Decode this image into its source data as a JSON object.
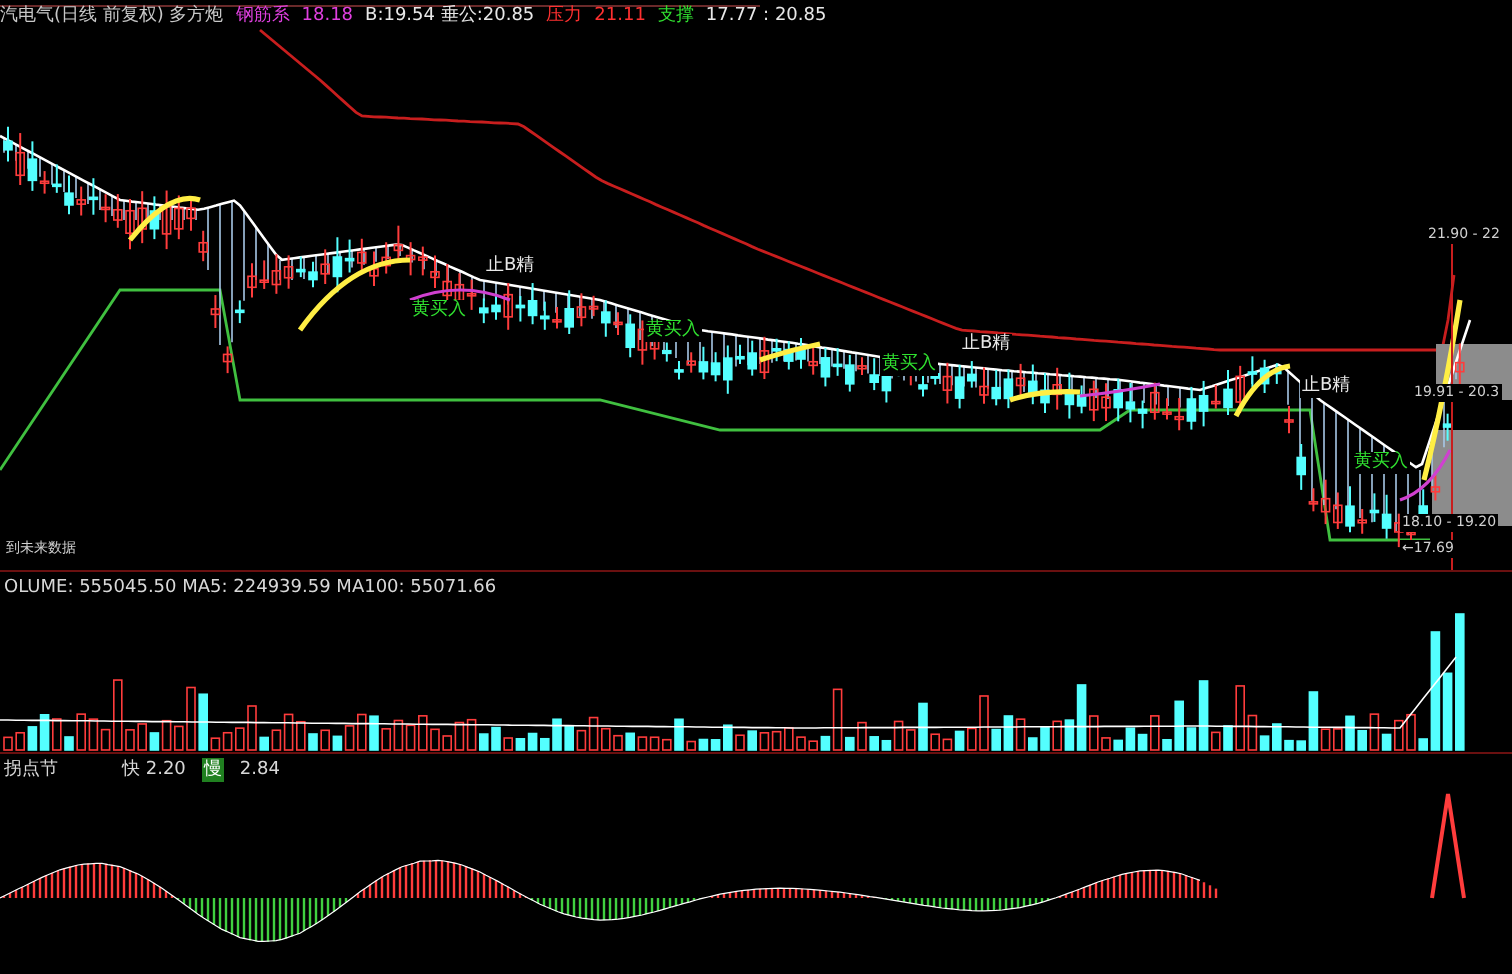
{
  "header": [
    {
      "text": "汽电气(日线 前复权) 多方炮",
      "color": "#c8c8c8"
    },
    {
      "text": "钢筋系",
      "color": "#e040e0"
    },
    {
      "text": "18.18",
      "color": "#e040e0"
    },
    {
      "text": "B:19.54 垂公:20.85",
      "color": "#e8e8e8"
    },
    {
      "text": "压力",
      "color": "#ff3030"
    },
    {
      "text": "21.11",
      "color": "#ff3030"
    },
    {
      "text": "支撑",
      "color": "#30e030"
    },
    {
      "text": "17.77 : 20.85",
      "color": "#e8e8e8"
    }
  ],
  "chart_labels": [
    {
      "text": "止B精",
      "color": "#e8e8e8"
    },
    {
      "text": "黄买入",
      "color": "#30e030"
    },
    {
      "text": "黄买入",
      "color": "#30e030"
    },
    {
      "text": "止B精",
      "color": "#e8e8e8"
    },
    {
      "text": "黄买入",
      "color": "#30e030"
    },
    {
      "text": "止B精",
      "color": "#e8e8e8"
    },
    {
      "text": "黄买入",
      "color": "#30e030"
    }
  ],
  "price_ranges": [
    "21.90 - 22",
    "19.91 - 20.3",
    "18.10 - 19.20",
    "←17.69"
  ],
  "future_data_label": "到未来数据",
  "volume": {
    "label": "OLUME: 555045.50 MA5: 224939.59 MA100: 55071.66"
  },
  "oscillator": {
    "title": "拐点节",
    "fast": "快 2.20",
    "slow_tag": "慢",
    "slow": "2.84"
  }
}
